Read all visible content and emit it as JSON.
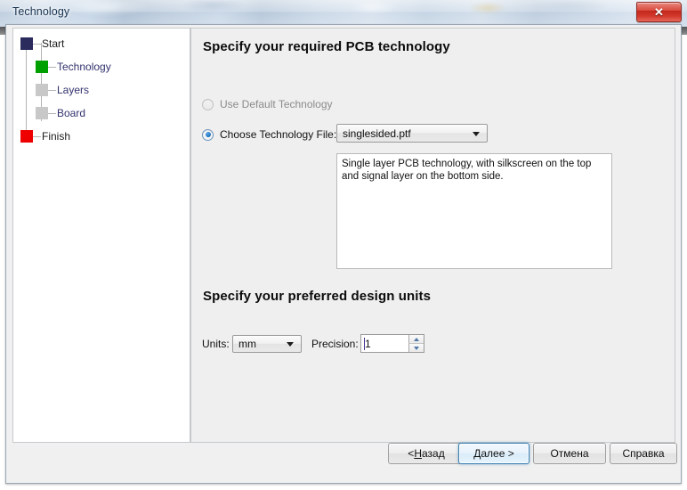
{
  "window": {
    "title": "Technology",
    "close_label": "✕",
    "close_icon": "close-icon"
  },
  "sidebar": {
    "items": [
      {
        "label": "Start",
        "color": "#2b2b5e",
        "level": 0,
        "state": "done"
      },
      {
        "label": "Technology",
        "color": "#00a000",
        "level": 1,
        "state": "current"
      },
      {
        "label": "Layers",
        "color": "#c8c8c8",
        "level": 1,
        "state": "pending"
      },
      {
        "label": "Board",
        "color": "#c8c8c8",
        "level": 1,
        "state": "pending"
      },
      {
        "label": "Finish",
        "color": "#ee0000",
        "level": 0,
        "state": "pending"
      }
    ]
  },
  "main": {
    "heading_technology": "Specify your required PCB technology",
    "heading_units": "Specify your preferred design units",
    "radio_default": {
      "label": "Use Default Technology",
      "selected": false,
      "disabled": true
    },
    "radio_file": {
      "label": "Choose Technology File:",
      "selected": true,
      "disabled": false
    },
    "technology_file": {
      "value": "singlesided.ptf",
      "options": [
        "singlesided.ptf"
      ]
    },
    "description": "Single layer PCB technology, with silkscreen on the top and signal layer on the bottom side.",
    "units": {
      "label": "Units:",
      "value": "mm",
      "options": [
        "mm"
      ]
    },
    "precision": {
      "label": "Precision:",
      "value": "1"
    }
  },
  "footer": {
    "back": {
      "prefix": "< ",
      "accel": "Н",
      "suffix": "азад"
    },
    "next": {
      "accel": "Д",
      "suffix": "алее >"
    },
    "cancel": "Отмена",
    "help": "Справка"
  },
  "colors": {
    "accent_blue": "#3c7fb1",
    "close_red": "#c4271c",
    "node_start": "#2b2b5e",
    "node_current": "#00a000",
    "node_pending": "#c8c8c8",
    "node_finish": "#ee0000",
    "tree_label": "#32326e",
    "panel_bg": "#efefef"
  }
}
